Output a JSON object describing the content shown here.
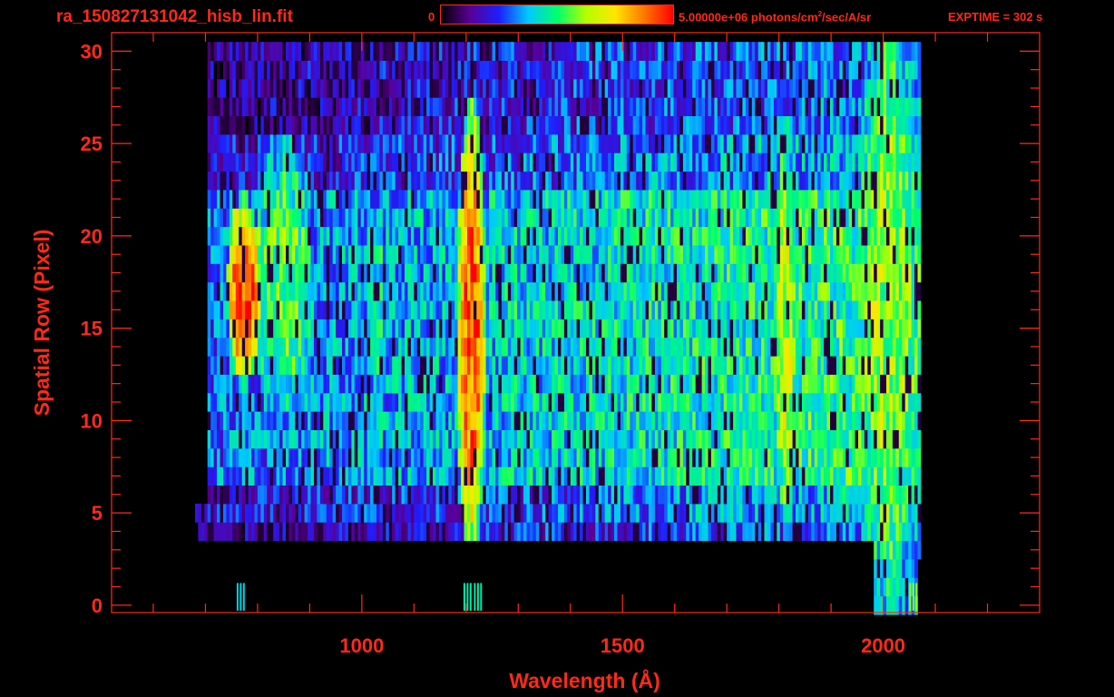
{
  "header": {
    "filename": "ra_150827131042_hisb_lin.fit",
    "colorbar_min_label": "0",
    "colorbar_max_prefix": "5.00000e+06 photons/cm",
    "colorbar_max_sup": "2",
    "colorbar_max_suffix": "/sec/A/sr",
    "exptime_label": "EXPTIME = 302 s"
  },
  "colors": {
    "background": "#000000",
    "axis_and_text": "#ff2a1a",
    "colormap": [
      "#000000",
      "#5a0096",
      "#1e1eff",
      "#00c8ff",
      "#00ff6e",
      "#b4ff00",
      "#ffe600",
      "#ff7800",
      "#ff0000"
    ]
  },
  "chart_data": {
    "type": "heatmap",
    "title": "",
    "xlabel": "Wavelength (Å)",
    "ylabel": "Spatial Row (Pixel)",
    "xlim": [
      520,
      2300
    ],
    "ylim": [
      -0.4,
      31
    ],
    "xticks": [
      1000,
      1500,
      2000
    ],
    "yticks": [
      0,
      5,
      10,
      15,
      20,
      25,
      30
    ],
    "colorbar": {
      "min": 0,
      "max": "5.00000e+06",
      "units": "photons/cm^2/sec/A/sr"
    },
    "grid": false,
    "emission_features": [
      {
        "name": "",
        "x_range": [
          745,
          800
        ],
        "y_range": [
          13,
          21
        ],
        "level": 0.95
      },
      {
        "name": "",
        "x_range": [
          795,
          900
        ],
        "y_range": [
          11,
          24
        ],
        "level": 0.55
      },
      {
        "name": "",
        "x_range": [
          1020,
          1040
        ],
        "y_range": [
          7,
          23
        ],
        "level": 0.45
      },
      {
        "name": "",
        "x_range": [
          1185,
          1230
        ],
        "y_range": [
          5,
          25
        ],
        "level": 0.9
      },
      {
        "name": "",
        "x_range": [
          1270,
          1300
        ],
        "y_range": [
          6,
          23
        ],
        "level": 0.45
      },
      {
        "name": "",
        "x_range": [
          1790,
          1830
        ],
        "y_range": [
          6,
          24
        ],
        "level": 0.65
      },
      {
        "name": "",
        "x_range": [
          1950,
          2065
        ],
        "y_range": [
          2,
          30
        ],
        "level": 0.6
      }
    ]
  }
}
